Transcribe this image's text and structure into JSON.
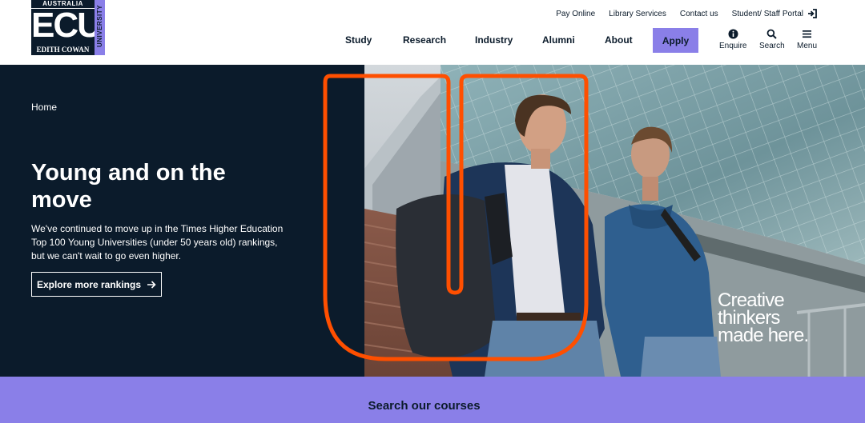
{
  "brand": {
    "top": "AUSTRALIA",
    "mark": "ECU",
    "name": "EDITH COWAN",
    "side": "UNIVERSITY",
    "accent": "#8a7fe8",
    "navy": "#0b1b2b",
    "highlight": "#ff4f00"
  },
  "utility_nav": {
    "pay_online": "Pay Online",
    "library_services": "Library Services",
    "contact_us": "Contact us",
    "portal": "Student/ Staff Portal",
    "portal_icon": "sign-in-icon"
  },
  "main_nav": {
    "study": "Study",
    "research": "Research",
    "industry": "Industry",
    "alumni": "Alumni",
    "about": "About",
    "apply": "Apply"
  },
  "icon_nav": {
    "enquire": "Enquire",
    "enquire_icon": "info-icon",
    "search": "Search",
    "search_icon": "search-icon",
    "menu": "Menu",
    "menu_icon": "hamburger-icon"
  },
  "hero": {
    "breadcrumb": "Home",
    "title": "Young and on the move",
    "text": "We've continued to move up in the Times Higher Education Top 100 Young Universities (under 50 years old) rankings, but we can't wait to go even higher.",
    "button": "Explore more rankings",
    "button_icon": "arrow-right-icon",
    "tagline": [
      "Creative",
      "thinkers",
      "made here."
    ]
  },
  "search": {
    "heading": "Search our courses"
  }
}
